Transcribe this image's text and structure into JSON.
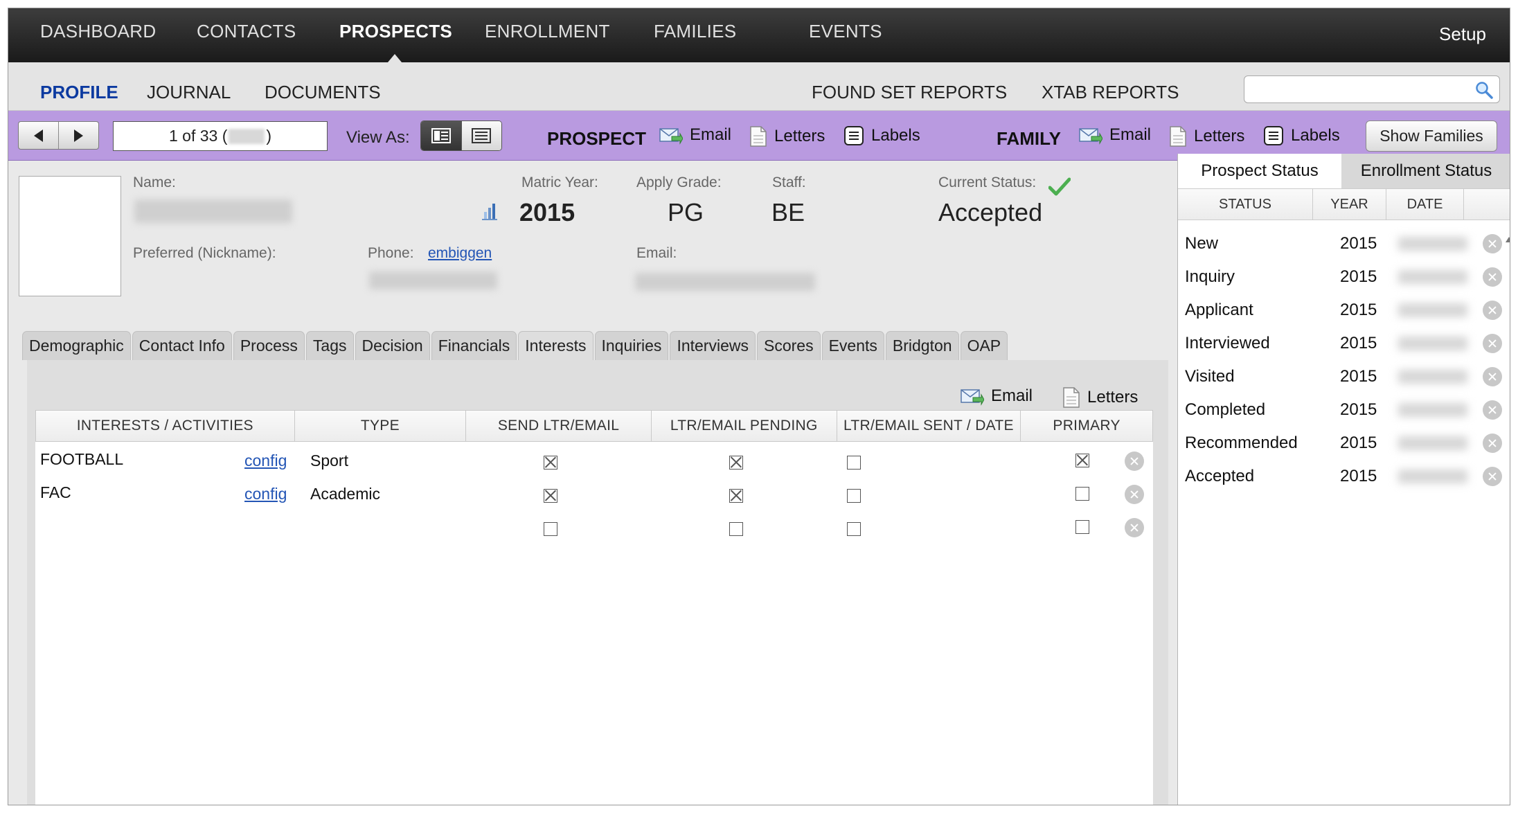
{
  "topnav": {
    "items": [
      "DASHBOARD",
      "CONTACTS",
      "PROSPECTS",
      "ENROLLMENT",
      "FAMILIES",
      "EVENTS"
    ],
    "active": "PROSPECTS",
    "setup": "Setup"
  },
  "subnav": {
    "left": [
      "PROFILE",
      "JOURNAL",
      "DOCUMENTS"
    ],
    "active": "PROFILE",
    "right": [
      "FOUND SET REPORTS",
      "XTAB REPORTS"
    ],
    "search_placeholder": ""
  },
  "toolbar": {
    "record_counter_prefix": "1 of 33 (",
    "record_counter_suffix": ")",
    "view_as": "View As:",
    "prospect": {
      "title": "PROSPECT",
      "email": "Email",
      "letters": "Letters",
      "labels": "Labels"
    },
    "family": {
      "title": "FAMILY",
      "email": "Email",
      "letters": "Letters",
      "labels": "Labels"
    },
    "show_families": "Show Families"
  },
  "profile": {
    "name_label": "Name:",
    "nickname_label": "Preferred (Nickname):",
    "matric_year_label": "Matric Year:",
    "matric_year": "2015",
    "apply_grade_label": "Apply Grade:",
    "apply_grade": "PG",
    "staff_label": "Staff:",
    "staff": "BE",
    "current_status_label": "Current Status:",
    "current_status": "Accepted",
    "phone_label": "Phone:",
    "phone_link": "embiggen",
    "email_label": "Email:"
  },
  "tabs": {
    "items": [
      "Demographic",
      "Contact Info",
      "Process",
      "Tags",
      "Decision",
      "Financials",
      "Interests",
      "Inquiries",
      "Interviews",
      "Scores",
      "Events",
      "Bridgton",
      "OAP"
    ],
    "active": "Interests"
  },
  "interests": {
    "email": "Email",
    "letters": "Letters",
    "columns": [
      "INTERESTS / ACTIVITIES",
      "TYPE",
      "SEND LTR/EMAIL",
      "LTR/EMAIL PENDING",
      "LTR/EMAIL SENT / DATE",
      "PRIMARY"
    ],
    "rows": [
      {
        "name": "FOOTBALL",
        "config": "config",
        "type": "Sport",
        "send": true,
        "pending": true,
        "sent": false,
        "primary": true
      },
      {
        "name": "FAC",
        "config": "config",
        "type": "Academic",
        "send": true,
        "pending": true,
        "sent": false,
        "primary": false
      },
      {
        "name": "",
        "config": "",
        "type": "",
        "send": false,
        "pending": false,
        "sent": false,
        "primary": false
      }
    ]
  },
  "status_panel": {
    "tabs": [
      "Prospect Status",
      "Enrollment Status"
    ],
    "active": "Prospect Status",
    "columns": [
      "STATUS",
      "YEAR",
      "DATE"
    ],
    "rows": [
      {
        "status": "New",
        "year": "2015"
      },
      {
        "status": "Inquiry",
        "year": "2015"
      },
      {
        "status": "Applicant",
        "year": "2015"
      },
      {
        "status": "Interviewed",
        "year": "2015"
      },
      {
        "status": "Visited",
        "year": "2015"
      },
      {
        "status": "Completed",
        "year": "2015"
      },
      {
        "status": "Recommended",
        "year": "2015"
      },
      {
        "status": "Accepted",
        "year": "2015"
      }
    ]
  },
  "colors": {
    "toolbar_purple": "#b99ae0",
    "active_blue": "#0c3aa0",
    "status_check": "#4caf50"
  }
}
